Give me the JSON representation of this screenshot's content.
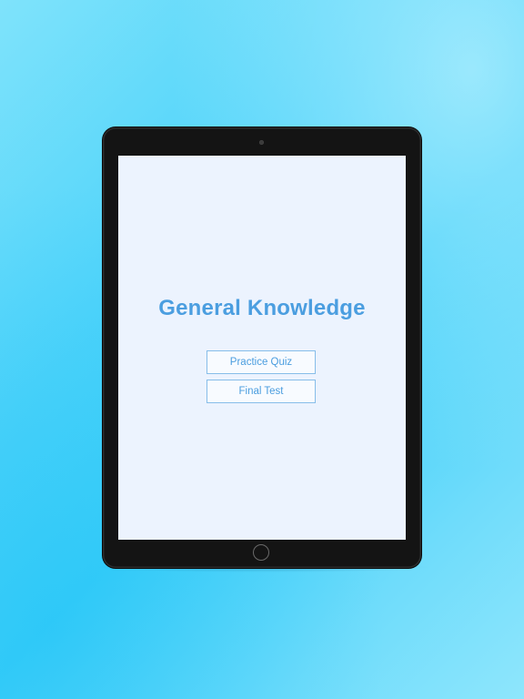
{
  "app": {
    "title": "General Knowledge"
  },
  "menu": {
    "practice_label": "Practice Quiz",
    "final_label": "Final Test"
  },
  "colors": {
    "accent": "#4b9ee0",
    "screen_background": "#ecf3fe",
    "page_background": "#3ccef9",
    "device_frame": "#141414"
  },
  "icons": {
    "camera": "camera-icon",
    "home": "home-button-icon"
  }
}
